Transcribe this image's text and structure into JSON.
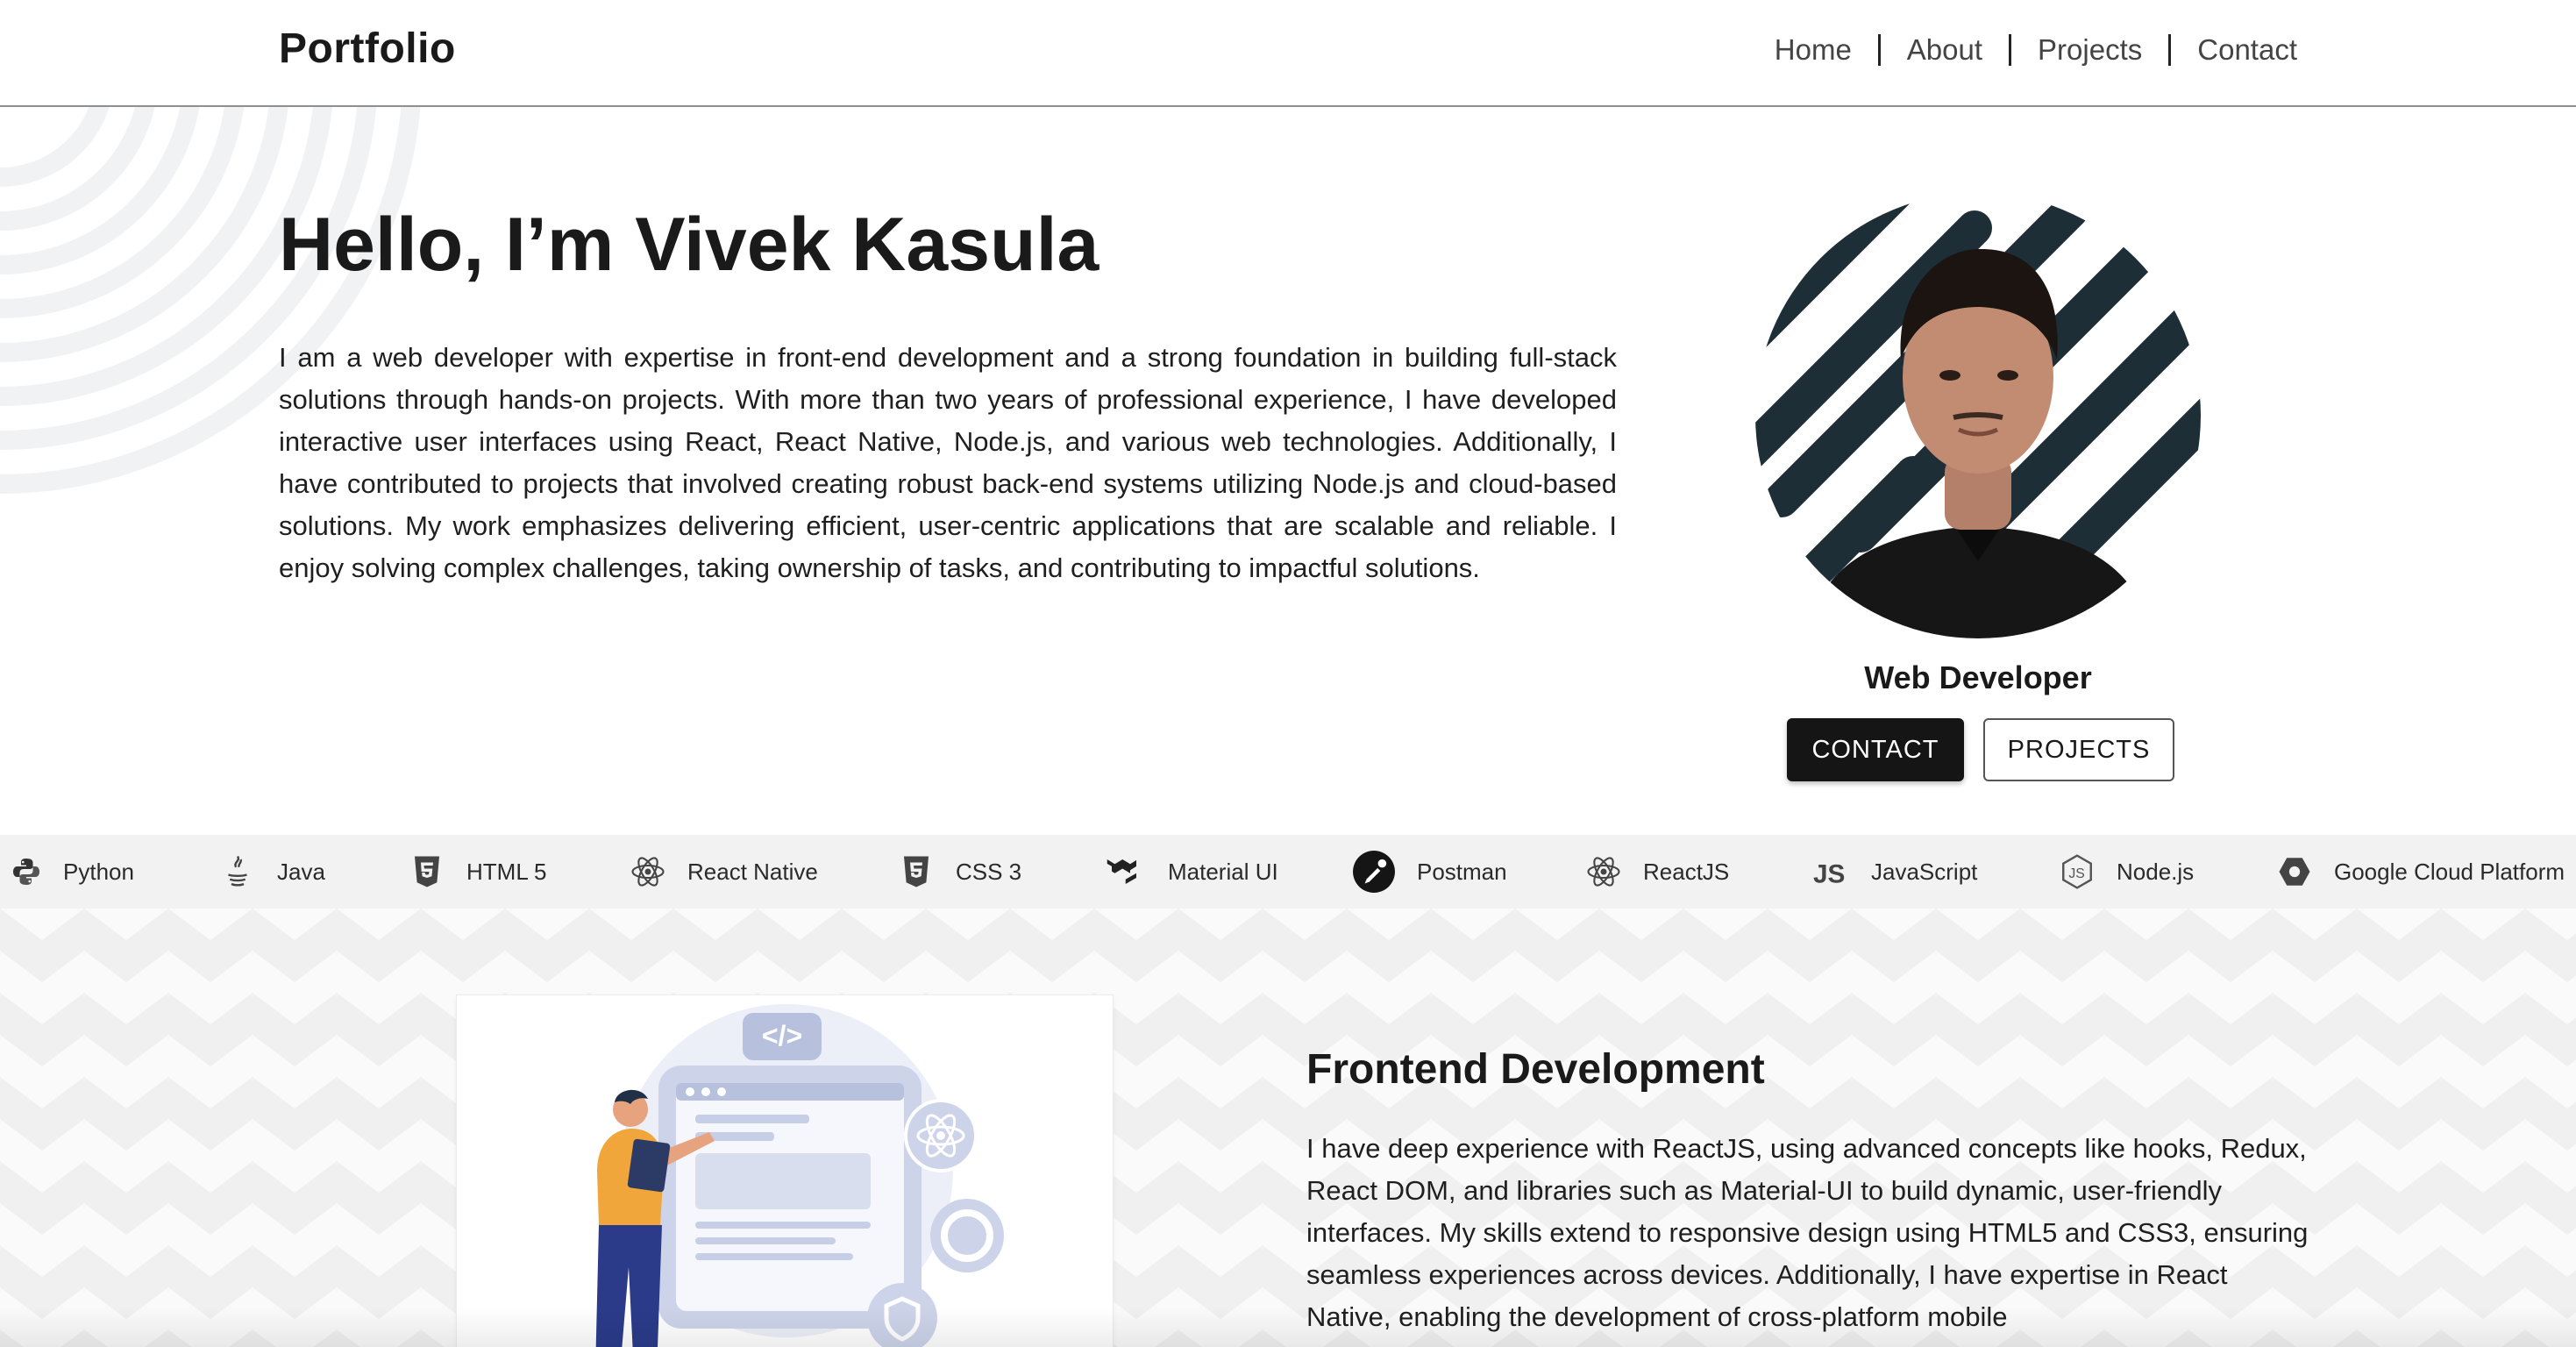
{
  "header": {
    "logo": "Portfolio",
    "nav": [
      "Home",
      "About",
      "Projects",
      "Contact"
    ]
  },
  "hero": {
    "title": "Hello, I’m Vivek Kasula",
    "bio": "I am a web developer with expertise in front-end development and a strong foundation in building full-stack solutions through hands-on projects. With more than two years of professional experience, I have developed interactive user interfaces using React, React Native, Node.js, and various web technologies. Additionally, I have contributed to projects that involved creating robust back-end systems utilizing Node.js and cloud-based solutions. My work emphasizes delivering efficient, user-centric applications that are scalable and reliable. I enjoy solving complex challenges, taking ownership of tasks, and contributing to impactful solutions.",
    "role": "Web Developer",
    "buttons": {
      "contact": "CONTACT",
      "projects": "PROJECTS"
    }
  },
  "skills": [
    {
      "label": "Python",
      "icon": "python-icon"
    },
    {
      "label": "Java",
      "icon": "java-icon"
    },
    {
      "label": "HTML 5",
      "icon": "html5-icon"
    },
    {
      "label": "React Native",
      "icon": "react-icon"
    },
    {
      "label": "CSS 3",
      "icon": "css3-icon"
    },
    {
      "label": "Material UI",
      "icon": "material-ui-icon"
    },
    {
      "label": "Postman",
      "icon": "postman-icon"
    },
    {
      "label": "ReactJS",
      "icon": "react-icon"
    },
    {
      "label": "JavaScript",
      "icon": "javascript-icon"
    },
    {
      "label": "Node.js",
      "icon": "nodejs-icon"
    },
    {
      "label": "Google Cloud Platform",
      "icon": "google-cloud-icon"
    }
  ],
  "service": {
    "title": "Frontend Development",
    "text": "I have deep experience with ReactJS, using advanced concepts like hooks, Redux, React DOM, and libraries such as Material-UI to build dynamic, user-friendly interfaces. My skills extend to responsive design using HTML5 and CSS3, ensuring seamless experiences across devices. Additionally, I have expertise in React Native, enabling the development of cross-platform mobile",
    "code_badge": "</>"
  },
  "colors": {
    "text": "#1a1a1a",
    "nav_text": "#444444",
    "button_dark": "#151515",
    "skills_bg": "#f2f2f2",
    "illustration_blue": "#b7c1de",
    "illustration_orange": "#f0a63a"
  }
}
